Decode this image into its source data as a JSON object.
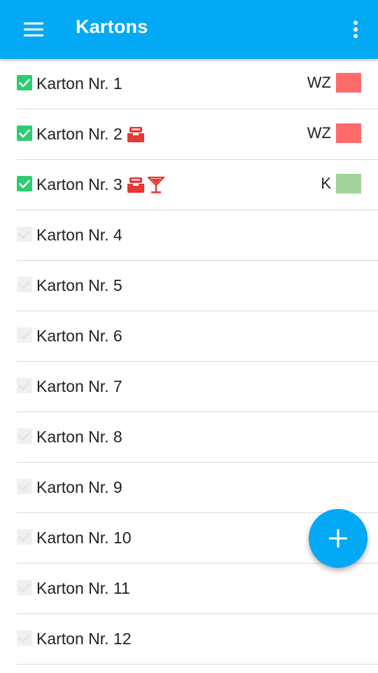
{
  "appbar": {
    "title": "Kartons",
    "menu_icon": "hamburger-menu-icon",
    "overflow_icon": "more-vertical-icon",
    "color": "#03a9f4"
  },
  "colors": {
    "checked": "#2ecc71",
    "unchecked": "#f0f0f0",
    "tag_red": "#ff6b6b",
    "tag_green": "#a3d39c",
    "icon_red": "#e53935"
  },
  "items": [
    {
      "label": "Karton Nr. 1",
      "checked": true,
      "icons": [],
      "tag": {
        "text": "WZ",
        "color": "#ff6b6b"
      }
    },
    {
      "label": "Karton Nr. 2",
      "checked": true,
      "icons": [
        "inbox-tray-icon"
      ],
      "tag": {
        "text": "WZ",
        "color": "#ff6b6b"
      }
    },
    {
      "label": "Karton Nr. 3",
      "checked": true,
      "icons": [
        "inbox-tray-icon",
        "cocktail-glass-icon"
      ],
      "tag": {
        "text": "K",
        "color": "#a3d39c"
      }
    },
    {
      "label": "Karton Nr. 4",
      "checked": false,
      "icons": [],
      "tag": null
    },
    {
      "label": "Karton Nr. 5",
      "checked": false,
      "icons": [],
      "tag": null
    },
    {
      "label": "Karton Nr. 6",
      "checked": false,
      "icons": [],
      "tag": null
    },
    {
      "label": "Karton Nr. 7",
      "checked": false,
      "icons": [],
      "tag": null
    },
    {
      "label": "Karton Nr. 8",
      "checked": false,
      "icons": [],
      "tag": null
    },
    {
      "label": "Karton Nr. 9",
      "checked": false,
      "icons": [],
      "tag": null
    },
    {
      "label": "Karton Nr. 10",
      "checked": false,
      "icons": [],
      "tag": null
    },
    {
      "label": "Karton Nr. 11",
      "checked": false,
      "icons": [],
      "tag": null
    },
    {
      "label": "Karton Nr. 12",
      "checked": false,
      "icons": [],
      "tag": null
    }
  ],
  "fab": {
    "icon": "plus-icon"
  }
}
